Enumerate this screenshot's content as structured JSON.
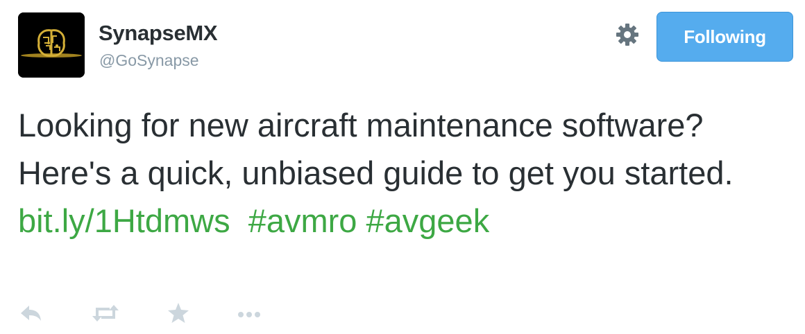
{
  "user": {
    "name": "SynapseMX",
    "handle": "@GoSynapse"
  },
  "follow_button": {
    "label": "Following"
  },
  "settings": {
    "icon": "gear-icon"
  },
  "tweet": {
    "text_plain": "Looking for new aircraft maintenance software? Here's a quick, unbiased guide to get you started.",
    "link": "bit.ly/1Htdmws",
    "hashtags": [
      "#avmro",
      "#avgeek"
    ]
  },
  "actions": [
    {
      "icon": "reply-icon"
    },
    {
      "icon": "retweet-icon"
    },
    {
      "icon": "favorite-star-icon"
    },
    {
      "icon": "more-icon"
    }
  ],
  "colors": {
    "text": "#292f33",
    "muted": "#8899a6",
    "link": "#3da844",
    "button": "#55acee",
    "action_icon": "#ccd6dd"
  }
}
